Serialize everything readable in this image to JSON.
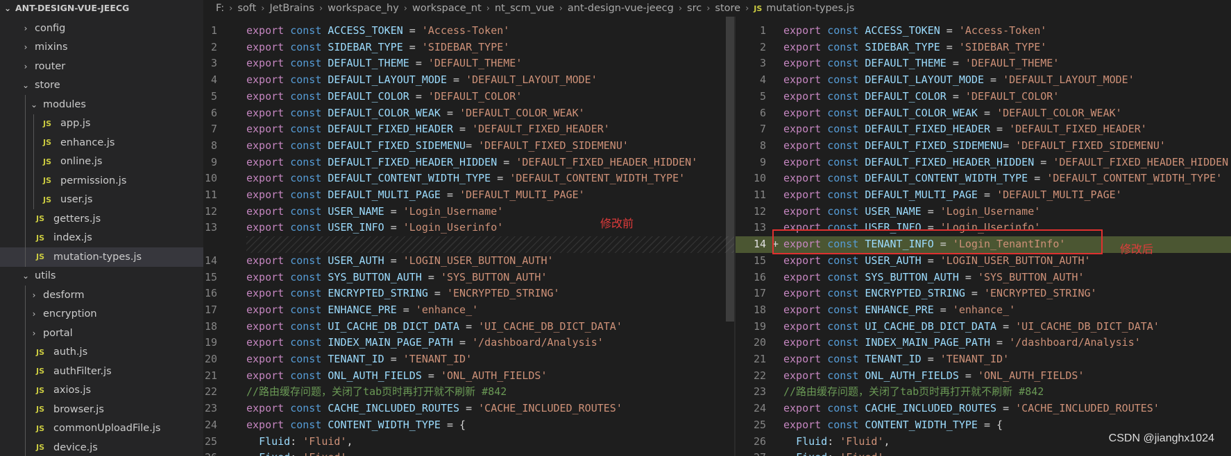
{
  "explorer": {
    "root_label": "ANT-DESIGN-VUE-JEECG",
    "items": [
      {
        "label": "config",
        "type": "folder",
        "expanded": false,
        "depth": 1
      },
      {
        "label": "mixins",
        "type": "folder",
        "expanded": false,
        "depth": 1
      },
      {
        "label": "router",
        "type": "folder",
        "expanded": false,
        "depth": 1
      },
      {
        "label": "store",
        "type": "folder",
        "expanded": true,
        "depth": 1
      },
      {
        "label": "modules",
        "type": "folder",
        "expanded": true,
        "depth": 2
      },
      {
        "label": "app.js",
        "type": "file",
        "depth": 3
      },
      {
        "label": "enhance.js",
        "type": "file",
        "depth": 3
      },
      {
        "label": "online.js",
        "type": "file",
        "depth": 3
      },
      {
        "label": "permission.js",
        "type": "file",
        "depth": 3
      },
      {
        "label": "user.js",
        "type": "file",
        "depth": 3
      },
      {
        "label": "getters.js",
        "type": "file",
        "depth": 2
      },
      {
        "label": "index.js",
        "type": "file",
        "depth": 2
      },
      {
        "label": "mutation-types.js",
        "type": "file",
        "depth": 2,
        "selected": true
      },
      {
        "label": "utils",
        "type": "folder",
        "expanded": true,
        "depth": 1
      },
      {
        "label": "desform",
        "type": "folder",
        "expanded": false,
        "depth": 2
      },
      {
        "label": "encryption",
        "type": "folder",
        "expanded": false,
        "depth": 2
      },
      {
        "label": "portal",
        "type": "folder",
        "expanded": false,
        "depth": 2
      },
      {
        "label": "auth.js",
        "type": "file",
        "depth": 2
      },
      {
        "label": "authFilter.js",
        "type": "file",
        "depth": 2
      },
      {
        "label": "axios.js",
        "type": "file",
        "depth": 2
      },
      {
        "label": "browser.js",
        "type": "file",
        "depth": 2
      },
      {
        "label": "commonUploadFile.js",
        "type": "file",
        "depth": 2
      },
      {
        "label": "device.js",
        "type": "file",
        "depth": 2
      }
    ]
  },
  "breadcrumb": {
    "parts": [
      "F:",
      "soft",
      "JetBrains",
      "workspace_hy",
      "workspace_nt",
      "nt_scm_vue",
      "ant-design-vue-jeecg",
      "src",
      "store"
    ],
    "file_icon": "JS",
    "file": "mutation-types.js"
  },
  "file_icon_text": "JS",
  "code": {
    "lines": [
      [
        [
          "kw",
          "export"
        ],
        [
          "op",
          " "
        ],
        [
          "st",
          "const"
        ],
        [
          "op",
          " "
        ],
        [
          "id",
          "ACCESS_TOKEN"
        ],
        [
          "op",
          " = "
        ],
        [
          "str",
          "'Access-Token'"
        ]
      ],
      [
        [
          "kw",
          "export"
        ],
        [
          "op",
          " "
        ],
        [
          "st",
          "const"
        ],
        [
          "op",
          " "
        ],
        [
          "id",
          "SIDEBAR_TYPE"
        ],
        [
          "op",
          " = "
        ],
        [
          "str",
          "'SIDEBAR_TYPE'"
        ]
      ],
      [
        [
          "kw",
          "export"
        ],
        [
          "op",
          " "
        ],
        [
          "st",
          "const"
        ],
        [
          "op",
          " "
        ],
        [
          "id",
          "DEFAULT_THEME"
        ],
        [
          "op",
          " = "
        ],
        [
          "str",
          "'DEFAULT_THEME'"
        ]
      ],
      [
        [
          "kw",
          "export"
        ],
        [
          "op",
          " "
        ],
        [
          "st",
          "const"
        ],
        [
          "op",
          " "
        ],
        [
          "id",
          "DEFAULT_LAYOUT_MODE"
        ],
        [
          "op",
          " = "
        ],
        [
          "str",
          "'DEFAULT_LAYOUT_MODE'"
        ]
      ],
      [
        [
          "kw",
          "export"
        ],
        [
          "op",
          " "
        ],
        [
          "st",
          "const"
        ],
        [
          "op",
          " "
        ],
        [
          "id",
          "DEFAULT_COLOR"
        ],
        [
          "op",
          " = "
        ],
        [
          "str",
          "'DEFAULT_COLOR'"
        ]
      ],
      [
        [
          "kw",
          "export"
        ],
        [
          "op",
          " "
        ],
        [
          "st",
          "const"
        ],
        [
          "op",
          " "
        ],
        [
          "id",
          "DEFAULT_COLOR_WEAK"
        ],
        [
          "op",
          " = "
        ],
        [
          "str",
          "'DEFAULT_COLOR_WEAK'"
        ]
      ],
      [
        [
          "kw",
          "export"
        ],
        [
          "op",
          " "
        ],
        [
          "st",
          "const"
        ],
        [
          "op",
          " "
        ],
        [
          "id",
          "DEFAULT_FIXED_HEADER"
        ],
        [
          "op",
          " = "
        ],
        [
          "str",
          "'DEFAULT_FIXED_HEADER'"
        ]
      ],
      [
        [
          "kw",
          "export"
        ],
        [
          "op",
          " "
        ],
        [
          "st",
          "const"
        ],
        [
          "op",
          " "
        ],
        [
          "id",
          "DEFAULT_FIXED_SIDEMENU"
        ],
        [
          "op",
          "= "
        ],
        [
          "str",
          "'DEFAULT_FIXED_SIDEMENU'"
        ]
      ],
      [
        [
          "kw",
          "export"
        ],
        [
          "op",
          " "
        ],
        [
          "st",
          "const"
        ],
        [
          "op",
          " "
        ],
        [
          "id",
          "DEFAULT_FIXED_HEADER_HIDDEN"
        ],
        [
          "op",
          " = "
        ],
        [
          "str",
          "'DEFAULT_FIXED_HEADER_HIDDEN'"
        ]
      ],
      [
        [
          "kw",
          "export"
        ],
        [
          "op",
          " "
        ],
        [
          "st",
          "const"
        ],
        [
          "op",
          " "
        ],
        [
          "id",
          "DEFAULT_CONTENT_WIDTH_TYPE"
        ],
        [
          "op",
          " = "
        ],
        [
          "str",
          "'DEFAULT_CONTENT_WIDTH_TYPE'"
        ]
      ],
      [
        [
          "kw",
          "export"
        ],
        [
          "op",
          " "
        ],
        [
          "st",
          "const"
        ],
        [
          "op",
          " "
        ],
        [
          "id",
          "DEFAULT_MULTI_PAGE"
        ],
        [
          "op",
          " = "
        ],
        [
          "str",
          "'DEFAULT_MULTI_PAGE'"
        ]
      ],
      [
        [
          "kw",
          "export"
        ],
        [
          "op",
          " "
        ],
        [
          "st",
          "const"
        ],
        [
          "op",
          " "
        ],
        [
          "id",
          "USER_NAME"
        ],
        [
          "op",
          " = "
        ],
        [
          "str",
          "'Login_Username'"
        ]
      ],
      [
        [
          "kw",
          "export"
        ],
        [
          "op",
          " "
        ],
        [
          "st",
          "const"
        ],
        [
          "op",
          " "
        ],
        [
          "id",
          "USER_INFO"
        ],
        [
          "op",
          " = "
        ],
        [
          "str",
          "'Login_Userinfo'"
        ]
      ],
      [
        [
          "kw",
          "export"
        ],
        [
          "op",
          " "
        ],
        [
          "st",
          "const"
        ],
        [
          "op",
          " "
        ],
        [
          "id",
          "TENANT_INFO"
        ],
        [
          "op",
          " = "
        ],
        [
          "str",
          "'Login_TenantInfo'"
        ]
      ],
      [
        [
          "kw",
          "export"
        ],
        [
          "op",
          " "
        ],
        [
          "st",
          "const"
        ],
        [
          "op",
          " "
        ],
        [
          "id",
          "USER_AUTH"
        ],
        [
          "op",
          " = "
        ],
        [
          "str",
          "'LOGIN_USER_BUTTON_AUTH'"
        ]
      ],
      [
        [
          "kw",
          "export"
        ],
        [
          "op",
          " "
        ],
        [
          "st",
          "const"
        ],
        [
          "op",
          " "
        ],
        [
          "id",
          "SYS_BUTTON_AUTH"
        ],
        [
          "op",
          " = "
        ],
        [
          "str",
          "'SYS_BUTTON_AUTH'"
        ]
      ],
      [
        [
          "kw",
          "export"
        ],
        [
          "op",
          " "
        ],
        [
          "st",
          "const"
        ],
        [
          "op",
          " "
        ],
        [
          "id",
          "ENCRYPTED_STRING"
        ],
        [
          "op",
          " = "
        ],
        [
          "str",
          "'ENCRYPTED_STRING'"
        ]
      ],
      [
        [
          "kw",
          "export"
        ],
        [
          "op",
          " "
        ],
        [
          "st",
          "const"
        ],
        [
          "op",
          " "
        ],
        [
          "id",
          "ENHANCE_PRE"
        ],
        [
          "op",
          " = "
        ],
        [
          "str",
          "'enhance_'"
        ]
      ],
      [
        [
          "kw",
          "export"
        ],
        [
          "op",
          " "
        ],
        [
          "st",
          "const"
        ],
        [
          "op",
          " "
        ],
        [
          "id",
          "UI_CACHE_DB_DICT_DATA"
        ],
        [
          "op",
          " = "
        ],
        [
          "str",
          "'UI_CACHE_DB_DICT_DATA'"
        ]
      ],
      [
        [
          "kw",
          "export"
        ],
        [
          "op",
          " "
        ],
        [
          "st",
          "const"
        ],
        [
          "op",
          " "
        ],
        [
          "id",
          "INDEX_MAIN_PAGE_PATH"
        ],
        [
          "op",
          " = "
        ],
        [
          "str",
          "'/dashboard/Analysis'"
        ]
      ],
      [
        [
          "kw",
          "export"
        ],
        [
          "op",
          " "
        ],
        [
          "st",
          "const"
        ],
        [
          "op",
          " "
        ],
        [
          "id",
          "TENANT_ID"
        ],
        [
          "op",
          " = "
        ],
        [
          "str",
          "'TENANT_ID'"
        ]
      ],
      [
        [
          "kw",
          "export"
        ],
        [
          "op",
          " "
        ],
        [
          "st",
          "const"
        ],
        [
          "op",
          " "
        ],
        [
          "id",
          "ONL_AUTH_FIELDS"
        ],
        [
          "op",
          " = "
        ],
        [
          "str",
          "'ONL_AUTH_FIELDS'"
        ]
      ],
      [
        [
          "cm",
          "//路由缓存问题，关闭了tab页时再打开就不刷新 #842"
        ]
      ],
      [
        [
          "kw",
          "export"
        ],
        [
          "op",
          " "
        ],
        [
          "st",
          "const"
        ],
        [
          "op",
          " "
        ],
        [
          "id",
          "CACHE_INCLUDED_ROUTES"
        ],
        [
          "op",
          " = "
        ],
        [
          "str",
          "'CACHE_INCLUDED_ROUTES'"
        ]
      ],
      [
        [
          "kw",
          "export"
        ],
        [
          "op",
          " "
        ],
        [
          "st",
          "const"
        ],
        [
          "op",
          " "
        ],
        [
          "id",
          "CONTENT_WIDTH_TYPE"
        ],
        [
          "op",
          " = {"
        ]
      ],
      [
        [
          "op",
          "  "
        ],
        [
          "id",
          "Fluid"
        ],
        [
          "op",
          ": "
        ],
        [
          "str",
          "'Fluid'"
        ],
        [
          "op",
          ","
        ]
      ],
      [
        [
          "op",
          "  "
        ],
        [
          "id",
          "Fixed"
        ],
        [
          "op",
          ": "
        ],
        [
          "str",
          "'Fixed'"
        ]
      ]
    ]
  },
  "left_pane": {
    "line_map": [
      1,
      2,
      3,
      4,
      5,
      6,
      7,
      8,
      9,
      10,
      11,
      12,
      13,
      null,
      15,
      16,
      17,
      18,
      19,
      20,
      21,
      22,
      23,
      24,
      25,
      26,
      27
    ],
    "numbers": [
      1,
      2,
      3,
      4,
      5,
      6,
      7,
      8,
      9,
      10,
      11,
      12,
      13,
      null,
      14,
      15,
      16,
      17,
      18,
      19,
      20,
      21,
      22,
      23,
      24,
      25,
      26
    ]
  },
  "right_pane": {
    "numbers": [
      1,
      2,
      3,
      4,
      5,
      6,
      7,
      8,
      9,
      10,
      11,
      12,
      13,
      14,
      15,
      16,
      17,
      18,
      19,
      20,
      21,
      22,
      23,
      24,
      25,
      26,
      27
    ],
    "added_line_index": 13,
    "added_marker": "+"
  },
  "annotations": {
    "before": "修改前",
    "after": "修改后"
  },
  "watermark": "CSDN @jianghx1024",
  "colors": {
    "keyword": "#c586c0",
    "storage": "#569cd6",
    "identifier": "#9cdcfe",
    "string": "#ce9178",
    "comment": "#6a9955",
    "added_line_bg": "#4b5632",
    "annotation_red": "#e03b3b"
  }
}
